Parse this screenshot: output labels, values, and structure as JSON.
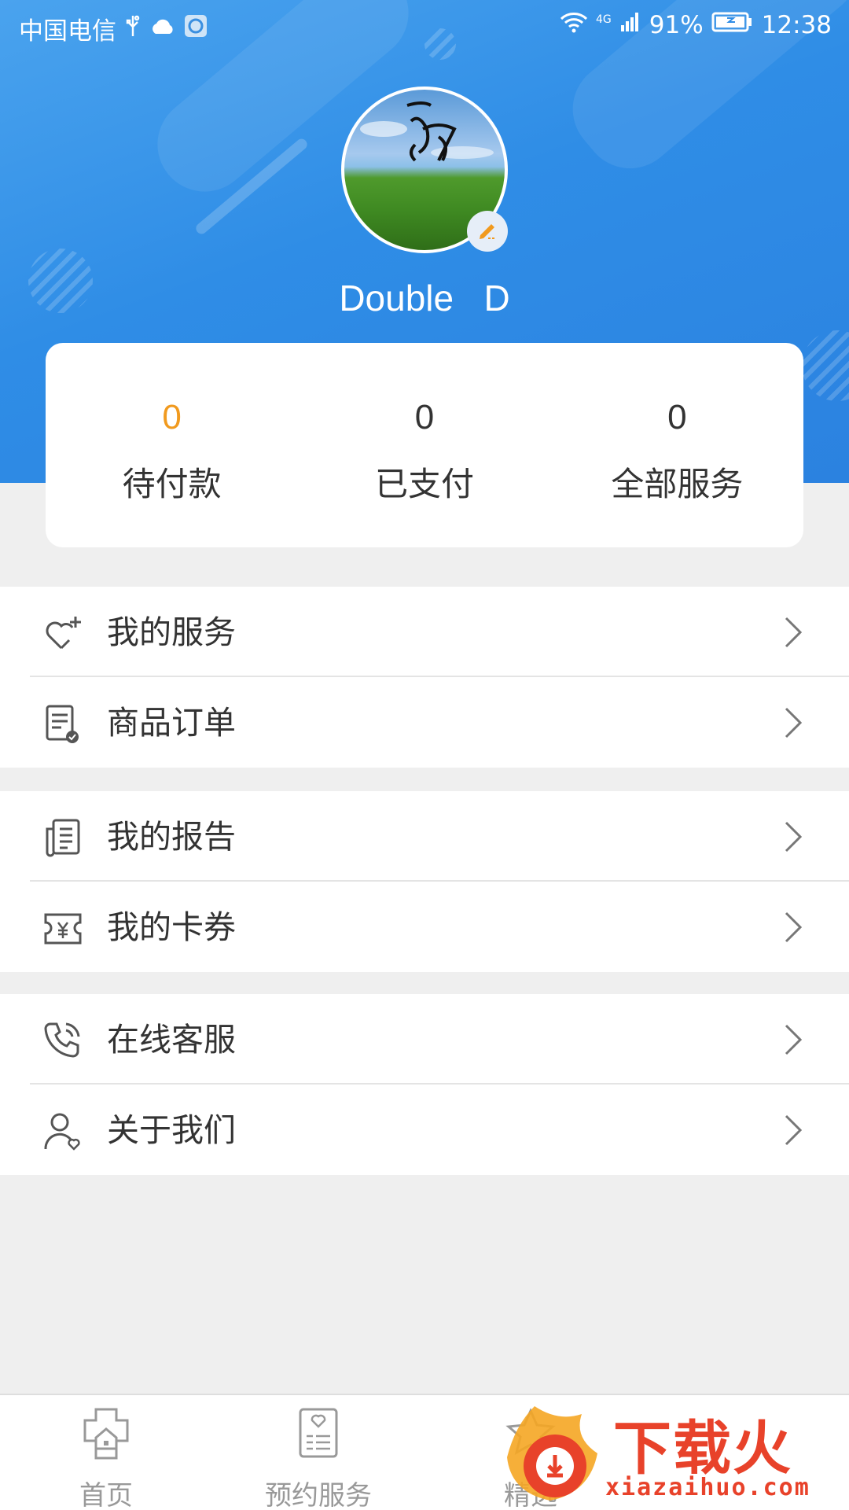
{
  "status_bar": {
    "carrier": "中国电信",
    "network": "4G",
    "battery": "91%",
    "time": "12:38"
  },
  "profile": {
    "username": "Double   D"
  },
  "stats": [
    {
      "value": "0",
      "label": "待付款"
    },
    {
      "value": "0",
      "label": "已支付"
    },
    {
      "value": "0",
      "label": "全部服务"
    }
  ],
  "menu": {
    "group1": [
      {
        "label": "我的服务",
        "icon": "heart-plus-icon"
      },
      {
        "label": "商品订单",
        "icon": "order-icon"
      }
    ],
    "group2": [
      {
        "label": "我的报告",
        "icon": "report-icon"
      },
      {
        "label": "我的卡券",
        "icon": "coupon-icon"
      }
    ],
    "group3": [
      {
        "label": "在线客服",
        "icon": "phone-icon"
      },
      {
        "label": "关于我们",
        "icon": "user-icon"
      }
    ]
  },
  "tabbar": {
    "tabs": [
      {
        "label": "首页",
        "icon": "home-icon"
      },
      {
        "label": "预约服务",
        "icon": "appointment-icon"
      },
      {
        "label": "精选",
        "icon": "featured-icon"
      }
    ]
  },
  "watermark": {
    "text": "下载火",
    "url": "xiazaihuo.com"
  },
  "colors": {
    "header_blue": "#2f8de6",
    "accent_orange": "#f19a1e",
    "watermark_red": "#e8422a"
  }
}
